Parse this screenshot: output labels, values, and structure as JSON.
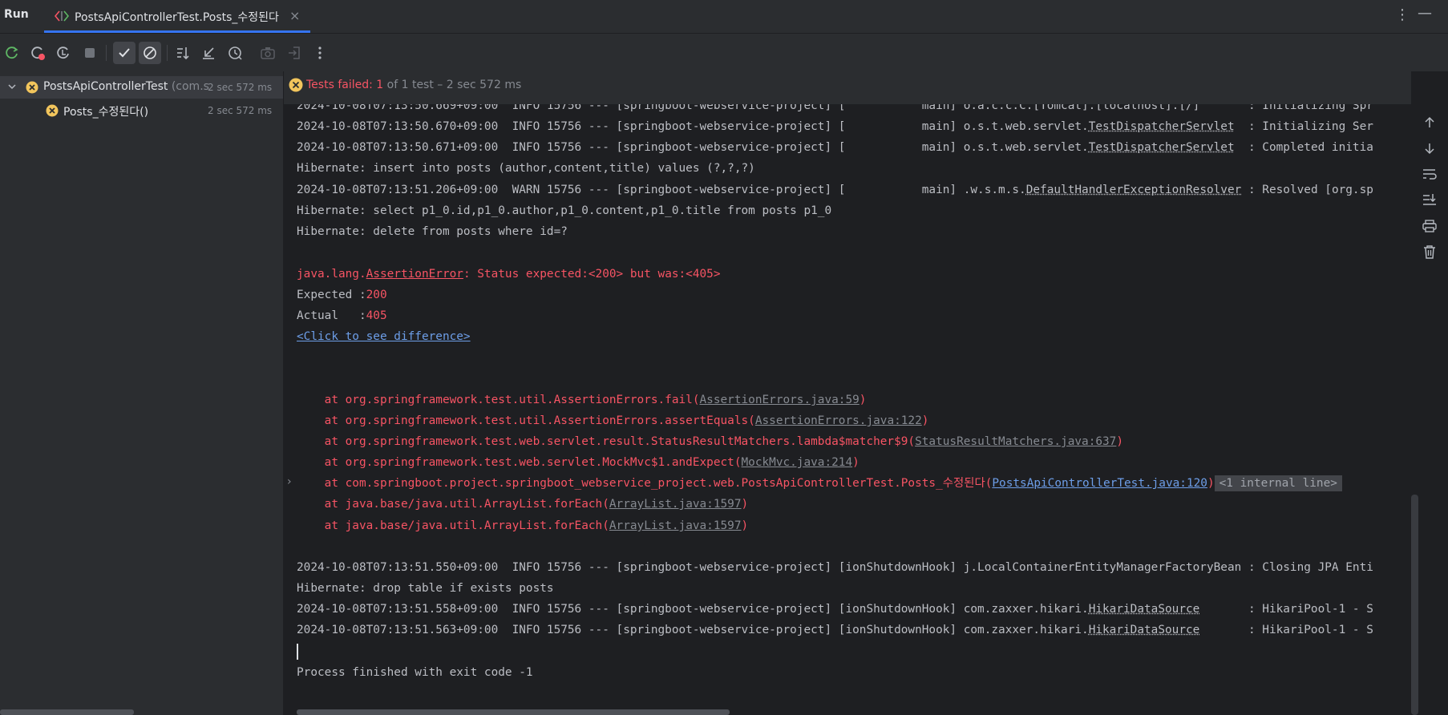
{
  "window": {
    "run_title": "Run",
    "tab_label": "PostsApiControllerTest.Posts_수정된다",
    "tab_close": "×",
    "more_icon": "⋮",
    "minimize_icon": "—"
  },
  "toolbar": {
    "buttons": [
      "rerun-icon",
      "rerun-failed-icon",
      "toggle-auto-test-icon",
      "stop-icon",
      "show-passed-icon",
      "show-ignored-icon",
      "sort-alphabetically-icon",
      "collapse-all-icon",
      "test-history-icon",
      "export-icon",
      "import-icon",
      "more-icon"
    ]
  },
  "tree": {
    "root": {
      "name": "PostsApiControllerTest",
      "pkg": " (com.s",
      "time": "2 sec 572 ms"
    },
    "child": {
      "name": "Posts_수정된다()",
      "time": "2 sec 572 ms"
    }
  },
  "status": {
    "failed_label": "Tests failed: ",
    "failed_count": "1",
    "summary": " of 1 test – 2 sec 572 ms"
  },
  "console": {
    "l0a": "2024-10-08T07:13:50.669+09:00  INFO 15756 --- [springboot-webservice-project] [           main] o.a.c.c.C.[Tomcat].[localhost].[/]       : Initializing Spr",
    "l1a": "2024-10-08T07:13:50.670+09:00  INFO 15756 --- [springboot-webservice-project] [           main] o.s.t.web.servlet.",
    "l1b": "TestDispatcherServlet",
    "l1c": "  : Initializing Ser",
    "l2a": "2024-10-08T07:13:50.671+09:00  INFO 15756 --- [springboot-webservice-project] [           main] o.s.t.web.servlet.",
    "l2b": "TestDispatcherServlet",
    "l2c": "  : Completed initia",
    "l3": "Hibernate: insert into posts (author,content,title) values (?,?,?)",
    "l4a": "2024-10-08T07:13:51.206+09:00  WARN 15756 --- [springboot-webservice-project] [           main] .w.s.m.s.",
    "l4b": "DefaultHandlerExceptionResolver",
    "l4c": " : Resolved [org.sp",
    "l5": "Hibernate: select p1_0.id,p1_0.author,p1_0.content,p1_0.title from posts p1_0",
    "l6": "Hibernate: delete from posts where id=?",
    "err_a": "java.lang.",
    "err_b": "AssertionError",
    "err_c": ": Status expected:<200> but was:<405>",
    "exp_label": "Expected :",
    "exp_val": "200",
    "act_label": "Actual   :",
    "act_val": "405",
    "diff_link": "<Click to see difference>",
    "st1a": "    at org.springframework.test.util.AssertionErrors.fail(",
    "st1b": "AssertionErrors.java:59",
    "st2a": "    at org.springframework.test.util.AssertionErrors.assertEquals(",
    "st2b": "AssertionErrors.java:122",
    "st3a": "    at org.springframework.test.web.servlet.result.StatusResultMatchers.lambda$matcher$9(",
    "st3b": "StatusResultMatchers.java:637",
    "st4a": "    at org.springframework.test.web.servlet.MockMvc$1.andExpect(",
    "st4b": "MockMvc.java:214",
    "st5a": "    at com.springboot.project.springboot_webservice_project.web.PostsApiControllerTest.Posts_수정된다(",
    "st5b": "PostsApiControllerTest.java:120",
    "st5c": "<1 internal line>",
    "st6a": "    at java.base/java.util.ArrayList.forEach(",
    "st6b": "ArrayList.java:1597",
    "st7a": "    at java.base/java.util.ArrayList.forEach(",
    "st7b": "ArrayList.java:1597",
    "c1": "2024-10-08T07:13:51.550+09:00  INFO 15756 --- [springboot-webservice-project] [ionShutdownHook] j.LocalContainerEntityManagerFactoryBean : Closing JPA Enti",
    "c2": "Hibernate: drop table if exists posts",
    "c3a": "2024-10-08T07:13:51.558+09:00  INFO 15756 --- [springboot-webservice-project] [ionShutdownHook] com.zaxxer.hikari.",
    "c3b": "HikariDataSource",
    "c3c": "       : HikariPool-1 - S",
    "c4a": "2024-10-08T07:13:51.563+09:00  INFO 15756 --- [springboot-webservice-project] [ionShutdownHook] com.zaxxer.hikari.",
    "c4b": "HikariDataSource",
    "c4c": "       : HikariPool-1 - S",
    "finish": "Process finished with exit code -1"
  },
  "colors": {
    "error": "#f75464",
    "link": "#6d9ee8",
    "accent": "#3574f0",
    "warning_icon": "#f2c55c"
  }
}
